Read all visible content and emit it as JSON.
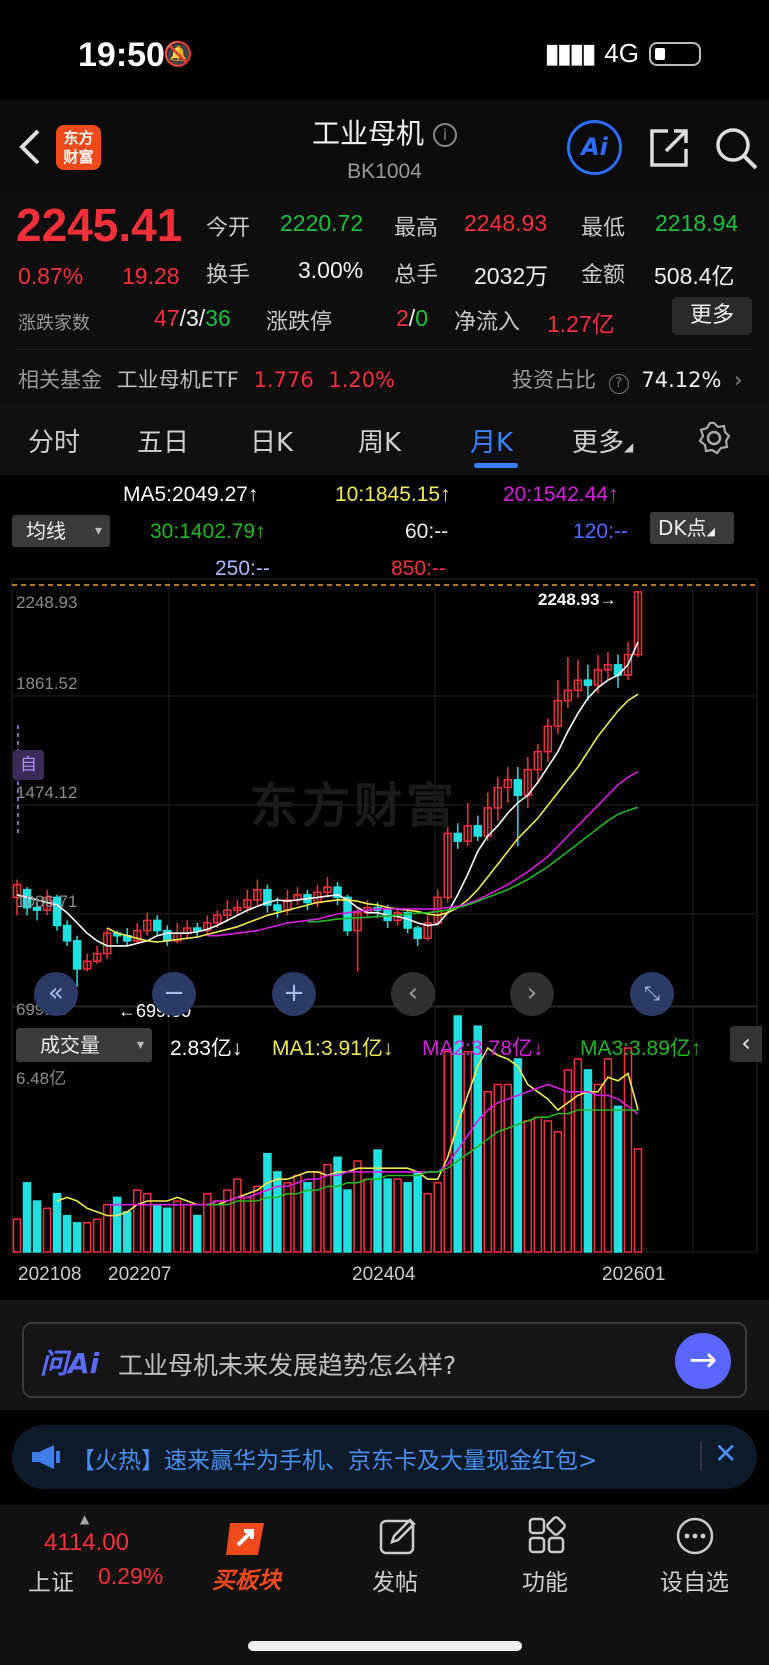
{
  "status": {
    "time": "19:50",
    "network": "4G"
  },
  "header": {
    "logo_line1": "东方",
    "logo_line2": "财富",
    "title": "工业母机",
    "code": "BK1004",
    "ai_label": "Ai"
  },
  "quote": {
    "price": "2245.41",
    "change_pct": "0.87%",
    "change": "19.28",
    "open_label": "今开",
    "open": "2220.72",
    "high_label": "最高",
    "high": "2248.93",
    "low_label": "最低",
    "low": "2218.94",
    "turnover_label": "换手",
    "turnover": "3.00%",
    "volume_label": "总手",
    "volume": "2032万",
    "amount_label": "金额",
    "amount": "508.4亿",
    "breadth_label": "涨跌家数",
    "up": "47",
    "flat": "3",
    "down": "36",
    "sep": "/",
    "limit_label": "涨跌停",
    "limit_up": "2",
    "limit_down": "0",
    "netflow_label": "净流入",
    "netflow": "1.27亿",
    "more_label": "更多"
  },
  "fund": {
    "label": "相关基金",
    "name": "工业母机ETF",
    "price": "1.776",
    "pct": "1.20%",
    "ratio_label": "投资占比",
    "ratio": "74.12%"
  },
  "tabs": [
    "分时",
    "五日",
    "日K",
    "周K",
    "月K",
    "更多"
  ],
  "active_tab": "月K",
  "ma_legend": {
    "selector": "均线",
    "ma5": "MA5:2049.27↑",
    "ma10": "10:1845.15↑",
    "ma20": "20:1542.44↑",
    "ma30": "30:1402.79↑",
    "ma60": "60:--",
    "ma120": "120:--",
    "ma250": "250:--",
    "ma850": "850:--",
    "dk": "DK点",
    "colors": {
      "ma5": "#ffffff",
      "ma10": "#f2e94e",
      "ma20": "#d81ee0",
      "ma30": "#1fb81f",
      "ma60": "#ffffff",
      "ma120": "#4a6cff",
      "ma250": "#a9b8ff",
      "ma850": "#f5303b"
    }
  },
  "chart": {
    "y_labels": [
      "2248.93",
      "1861.52",
      "1474.12",
      "1086.71",
      "699.30"
    ],
    "max_marker": "2248.93→",
    "min_marker": "←699.30",
    "auto_label": "自",
    "watermark": "东方财富"
  },
  "volume_panel": {
    "selector": "成交量",
    "current": "2.83亿↓",
    "ma1": "MA1:3.91亿↓",
    "ma2": "MA2:3.78亿↓",
    "ma3": "MA3:3.89亿↑",
    "y_max": "6.48亿"
  },
  "x_labels": [
    "202108",
    "202207",
    "202404",
    "202601"
  ],
  "chart_data": {
    "type": "candlestick",
    "period": "monthly",
    "ylim": [
      699.3,
      2248.93
    ],
    "candles": [
      [
        1050,
        1100,
        1120,
        980,
        "u"
      ],
      [
        1080,
        1010,
        1090,
        980,
        "d"
      ],
      [
        1010,
        1000,
        1030,
        960,
        "d"
      ],
      [
        1000,
        1050,
        1080,
        980,
        "u"
      ],
      [
        1050,
        940,
        1060,
        920,
        "d"
      ],
      [
        940,
        880,
        960,
        860,
        "d"
      ],
      [
        880,
        770,
        900,
        700,
        "d"
      ],
      [
        770,
        800,
        830,
        760,
        "u"
      ],
      [
        800,
        830,
        860,
        790,
        "u"
      ],
      [
        830,
        910,
        930,
        810,
        "u"
      ],
      [
        910,
        900,
        920,
        870,
        "d"
      ],
      [
        900,
        880,
        930,
        860,
        "d"
      ],
      [
        880,
        920,
        950,
        870,
        "u"
      ],
      [
        920,
        960,
        990,
        900,
        "u"
      ],
      [
        960,
        920,
        980,
        900,
        "d"
      ],
      [
        920,
        880,
        940,
        860,
        "d"
      ],
      [
        880,
        910,
        950,
        870,
        "u"
      ],
      [
        910,
        930,
        960,
        890,
        "u"
      ],
      [
        930,
        920,
        950,
        890,
        "d"
      ],
      [
        920,
        950,
        980,
        900,
        "u"
      ],
      [
        950,
        980,
        1000,
        930,
        "u"
      ],
      [
        980,
        1000,
        1040,
        960,
        "u"
      ],
      [
        1000,
        1010,
        1040,
        980,
        "u"
      ],
      [
        1010,
        1040,
        1080,
        990,
        "u"
      ],
      [
        1040,
        1080,
        1120,
        1020,
        "u"
      ],
      [
        1080,
        1020,
        1100,
        990,
        "d"
      ],
      [
        1020,
        1000,
        1050,
        970,
        "d"
      ],
      [
        1000,
        1040,
        1080,
        980,
        "u"
      ],
      [
        1040,
        1060,
        1090,
        1020,
        "u"
      ],
      [
        1060,
        1030,
        1080,
        1000,
        "d"
      ],
      [
        1030,
        1070,
        1100,
        1010,
        "u"
      ],
      [
        1070,
        1090,
        1130,
        1050,
        "u"
      ],
      [
        1090,
        1050,
        1110,
        1020,
        "d"
      ],
      [
        1050,
        920,
        1060,
        900,
        "d"
      ],
      [
        920,
        990,
        1010,
        760,
        "u"
      ],
      [
        990,
        1010,
        1040,
        970,
        "u"
      ],
      [
        1010,
        1000,
        1030,
        970,
        "d"
      ],
      [
        1000,
        960,
        1020,
        930,
        "d"
      ],
      [
        960,
        990,
        1010,
        940,
        "u"
      ],
      [
        990,
        930,
        1000,
        910,
        "d"
      ],
      [
        930,
        890,
        940,
        860,
        "d"
      ],
      [
        890,
        950,
        980,
        880,
        "u"
      ],
      [
        950,
        1050,
        1080,
        940,
        "u"
      ],
      [
        1050,
        1300,
        1330,
        1030,
        "u"
      ],
      [
        1300,
        1270,
        1340,
        1240,
        "d"
      ],
      [
        1270,
        1330,
        1420,
        1250,
        "u"
      ],
      [
        1330,
        1290,
        1370,
        1270,
        "d"
      ],
      [
        1290,
        1400,
        1460,
        1270,
        "u"
      ],
      [
        1400,
        1480,
        1520,
        1350,
        "u"
      ],
      [
        1480,
        1510,
        1560,
        1420,
        "u"
      ],
      [
        1510,
        1450,
        1560,
        1250,
        "d"
      ],
      [
        1450,
        1550,
        1600,
        1400,
        "u"
      ],
      [
        1550,
        1620,
        1650,
        1500,
        "u"
      ],
      [
        1620,
        1720,
        1750,
        1580,
        "u"
      ],
      [
        1720,
        1820,
        1900,
        1690,
        "u"
      ],
      [
        1820,
        1860,
        1990,
        1790,
        "u"
      ],
      [
        1860,
        1900,
        1980,
        1830,
        "u"
      ],
      [
        1900,
        1880,
        1960,
        1820,
        "d"
      ],
      [
        1880,
        1940,
        2000,
        1850,
        "u"
      ],
      [
        1940,
        1960,
        2010,
        1900,
        "u"
      ],
      [
        1960,
        1920,
        2000,
        1870,
        "d"
      ],
      [
        1920,
        2000,
        2050,
        1900,
        "u"
      ],
      [
        2000,
        2245.41,
        2248.93,
        1990,
        "u"
      ]
    ],
    "ma": {
      "ma5": [
        1060,
        1050,
        1040,
        1030,
        1020,
        990,
        950,
        910,
        880,
        860,
        860,
        860,
        870,
        880,
        900,
        910,
        910,
        910,
        915,
        925,
        940,
        960,
        980,
        1000,
        1015,
        1030,
        1040,
        1035,
        1040,
        1045,
        1050,
        1055,
        1060,
        1040,
        1010,
        990,
        990,
        980,
        975,
        965,
        950,
        940,
        945,
        990,
        1060,
        1140,
        1230,
        1290,
        1330,
        1380,
        1420,
        1450,
        1500,
        1560,
        1620,
        1700,
        1770,
        1830,
        1870,
        1900,
        1920,
        1960,
        2049.27
      ],
      "ma10": [
        null,
        null,
        null,
        null,
        null,
        null,
        null,
        null,
        null,
        930,
        910,
        900,
        890,
        880,
        875,
        880,
        885,
        890,
        895,
        905,
        915,
        925,
        935,
        950,
        965,
        980,
        990,
        1000,
        1010,
        1020,
        1030,
        1035,
        1040,
        1040,
        1035,
        1025,
        1020,
        1010,
        1005,
        1000,
        995,
        985,
        980,
        990,
        1010,
        1040,
        1080,
        1130,
        1180,
        1230,
        1280,
        1320,
        1360,
        1410,
        1460,
        1510,
        1560,
        1620,
        1680,
        1730,
        1780,
        1820,
        1845.15
      ],
      "ma20": [
        null,
        null,
        null,
        null,
        null,
        null,
        null,
        null,
        null,
        null,
        null,
        null,
        null,
        null,
        null,
        null,
        null,
        null,
        null,
        900,
        900,
        905,
        910,
        915,
        920,
        930,
        940,
        950,
        955,
        960,
        965,
        975,
        985,
        990,
        995,
        1000,
        1005,
        1005,
        1005,
        1005,
        1005,
        1005,
        1005,
        1010,
        1015,
        1025,
        1040,
        1060,
        1080,
        1100,
        1125,
        1150,
        1180,
        1210,
        1250,
        1290,
        1330,
        1370,
        1410,
        1450,
        1490,
        1520,
        1542.44
      ],
      "ma30": [
        null,
        null,
        null,
        null,
        null,
        null,
        null,
        null,
        null,
        null,
        null,
        null,
        null,
        null,
        null,
        null,
        null,
        null,
        null,
        null,
        null,
        null,
        null,
        null,
        null,
        null,
        null,
        null,
        null,
        955,
        955,
        960,
        965,
        968,
        970,
        972,
        975,
        978,
        980,
        985,
        988,
        990,
        995,
        1000,
        1010,
        1020,
        1035,
        1050,
        1065,
        1080,
        1100,
        1120,
        1145,
        1170,
        1200,
        1230,
        1260,
        1290,
        1320,
        1350,
        1375,
        1390,
        1402.79
      ]
    },
    "volume": {
      "unit": "亿",
      "ylim": [
        0,
        6.48
      ],
      "bars": [
        0.9,
        1.9,
        1.4,
        1.2,
        1.6,
        1.0,
        0.8,
        0.8,
        0.9,
        1.3,
        1.5,
        1.1,
        1.7,
        1.6,
        1.3,
        1.2,
        1.4,
        1.3,
        1.0,
        1.6,
        1.4,
        1.7,
        2.0,
        1.5,
        1.8,
        2.7,
        2.2,
        1.9,
        2.1,
        1.9,
        2.2,
        2.4,
        2.6,
        1.7,
        2.5,
        2.0,
        2.8,
        2.0,
        2.0,
        1.9,
        2.2,
        1.6,
        1.9,
        5.5,
        6.48,
        5.5,
        6.2,
        4.4,
        4.6,
        4.6,
        5.3,
        3.6,
        3.7,
        3.6,
        3.3,
        5.0,
        5.3,
        5.0,
        4.6,
        5.3,
        4.0,
        5.6,
        2.83
      ],
      "ma1": [
        null,
        null,
        null,
        null,
        1.4,
        1.5,
        1.4,
        1.2,
        1.1,
        1.0,
        1.0,
        1.1,
        1.3,
        1.4,
        1.4,
        1.4,
        1.5,
        1.4,
        1.3,
        1.3,
        1.3,
        1.4,
        1.5,
        1.6,
        1.7,
        1.9,
        2.0,
        2.0,
        2.1,
        2.2,
        2.2,
        2.1,
        2.2,
        2.2,
        2.3,
        2.3,
        2.3,
        2.3,
        2.3,
        2.3,
        2.2,
        2.0,
        2.0,
        2.6,
        3.5,
        4.3,
        5.1,
        5.6,
        5.4,
        5.3,
        5.1,
        4.6,
        4.4,
        4.2,
        3.9,
        4.1,
        4.3,
        4.4,
        4.4,
        4.8,
        4.7,
        4.9,
        3.91
      ],
      "ma2": [
        null,
        null,
        null,
        null,
        null,
        null,
        null,
        null,
        null,
        1.3,
        1.3,
        1.3,
        1.3,
        1.3,
        1.3,
        1.3,
        1.3,
        1.3,
        1.3,
        1.3,
        1.4,
        1.4,
        1.5,
        1.5,
        1.6,
        1.7,
        1.8,
        1.8,
        1.9,
        2.0,
        2.0,
        2.1,
        2.1,
        2.2,
        2.2,
        2.2,
        2.2,
        2.2,
        2.2,
        2.2,
        2.2,
        2.2,
        2.2,
        2.4,
        2.8,
        3.2,
        3.6,
        3.9,
        4.1,
        4.2,
        4.3,
        4.4,
        4.5,
        4.6,
        4.5,
        4.4,
        4.4,
        4.4,
        4.3,
        4.3,
        4.2,
        4.0,
        3.78
      ],
      "ma3": [
        null,
        null,
        null,
        null,
        null,
        null,
        null,
        null,
        null,
        null,
        null,
        null,
        null,
        null,
        null,
        null,
        null,
        null,
        null,
        1.3,
        1.3,
        1.3,
        1.4,
        1.4,
        1.4,
        1.5,
        1.5,
        1.6,
        1.6,
        1.7,
        1.7,
        1.8,
        1.8,
        1.9,
        1.9,
        2.0,
        2.0,
        2.1,
        2.1,
        2.1,
        2.1,
        2.2,
        2.2,
        2.3,
        2.5,
        2.7,
        2.9,
        3.1,
        3.3,
        3.4,
        3.5,
        3.6,
        3.7,
        3.7,
        3.8,
        3.8,
        3.9,
        3.9,
        3.9,
        3.9,
        3.9,
        3.9,
        3.89
      ]
    }
  },
  "ai_bar": {
    "logo": "问Ai",
    "question": "工业母机未来发展趋势怎么样?"
  },
  "ad": {
    "text": "【火热】速来赢华为手机、京东卡及大量现金红包>"
  },
  "bottom": {
    "index_value": "4114.00",
    "index_name": "上证",
    "index_pct": "0.29%",
    "buy_label": "买板块",
    "post_label": "发帖",
    "func_label": "功能",
    "fav_label": "设自选"
  }
}
